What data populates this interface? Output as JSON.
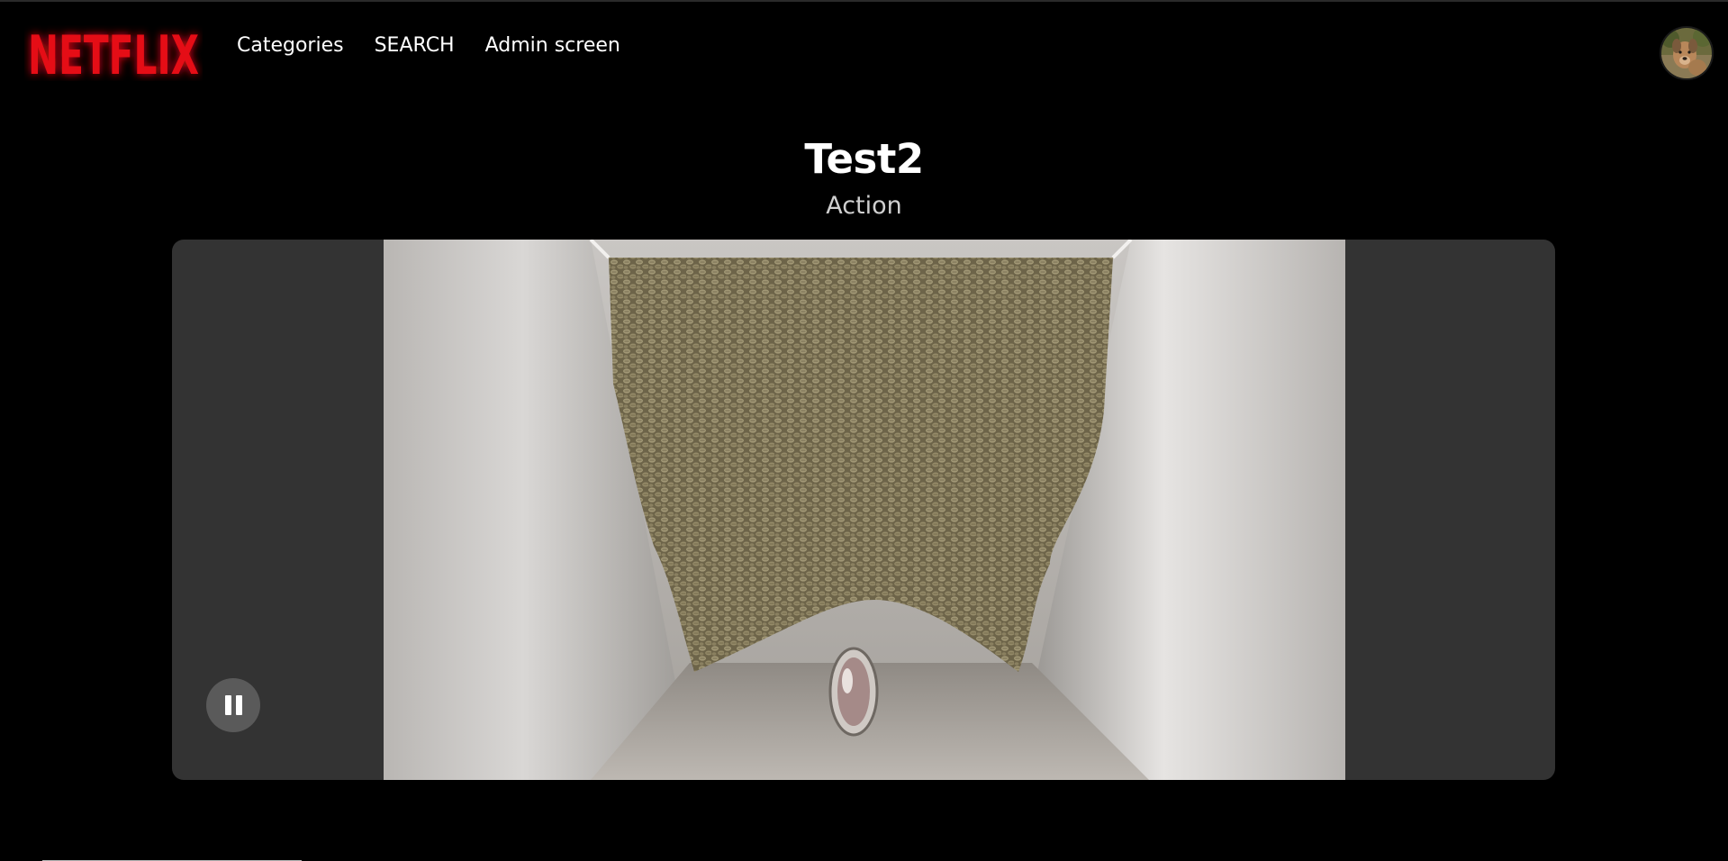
{
  "header": {
    "logo_text": "NETFLIX",
    "nav": [
      {
        "label": "Categories"
      },
      {
        "label": "SEARCH"
      },
      {
        "label": "Admin screen"
      }
    ]
  },
  "movie": {
    "title": "Test2",
    "genre": "Action"
  },
  "player": {
    "state": "playing",
    "control_icon": "pause-icon"
  },
  "colors": {
    "brand": "#e50914",
    "background": "#000000",
    "player_bg": "#333333"
  }
}
